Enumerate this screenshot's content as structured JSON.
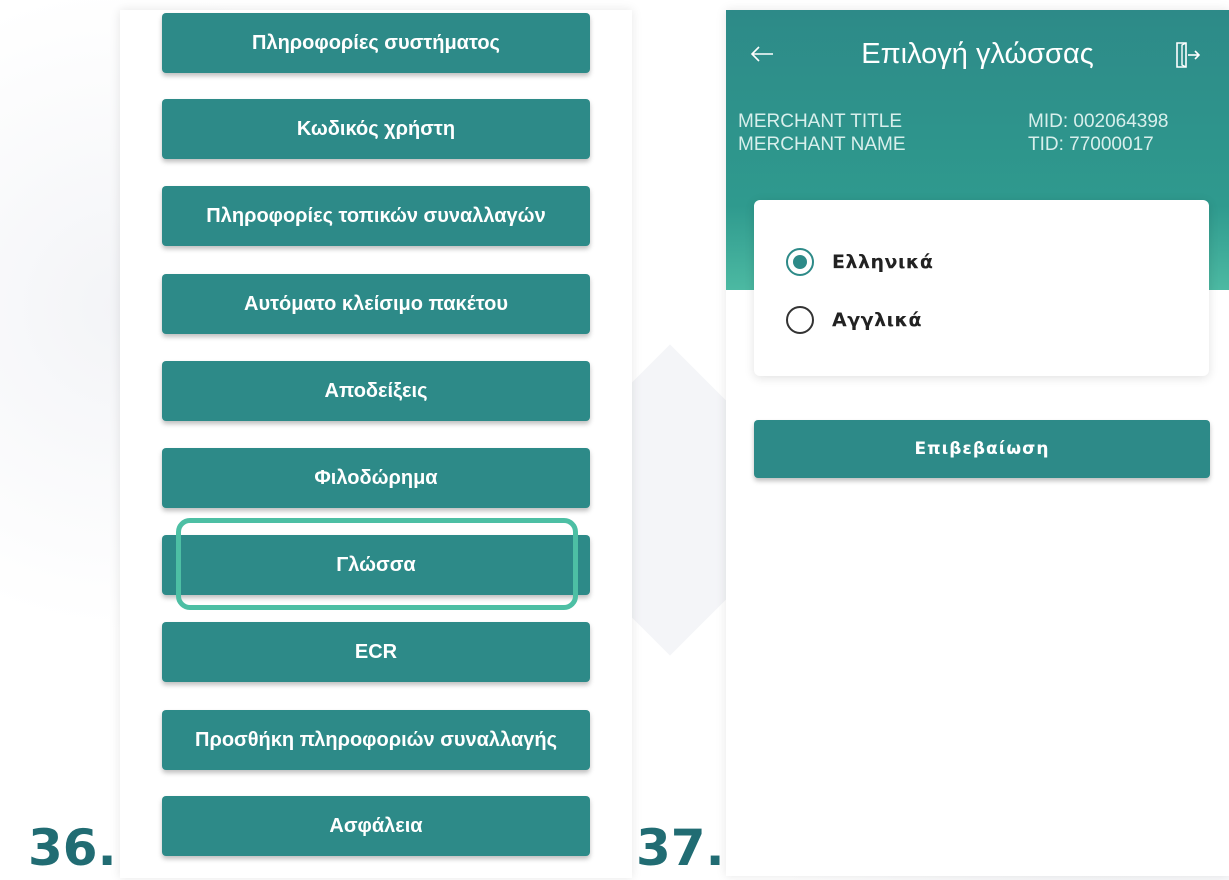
{
  "menu": {
    "items": [
      {
        "label": "Πληροφορίες συστήματος"
      },
      {
        "label": "Κωδικός χρήστη"
      },
      {
        "label": "Πληροφορίες τοπικών συναλλαγών"
      },
      {
        "label": "Αυτόματο κλείσιμο πακέτου"
      },
      {
        "label": "Αποδείξεις"
      },
      {
        "label": "Φιλοδώρημα"
      },
      {
        "label": "Γλώσσα"
      },
      {
        "label": "ECR"
      },
      {
        "label": "Προσθήκη πληροφοριών συναλλαγής"
      },
      {
        "label": "Ασφάλεια"
      }
    ],
    "highlighted_index": 6
  },
  "language_screen": {
    "back_icon": "arrow-left-icon",
    "title": "Επιλογή γλώσσας",
    "exit_icon": "logout-icon",
    "merchant_title": "MERCHANT TITLE",
    "merchant_name": "MERCHANT NAME",
    "mid": "MID: 002064398",
    "tid": "TID: 77000017",
    "options": [
      {
        "label": "Ελληνικά",
        "selected": true
      },
      {
        "label": "Αγγλικά",
        "selected": false
      }
    ],
    "confirm_label": "Επιβεβαίωση"
  },
  "steps": {
    "left": "36.",
    "right": "37."
  },
  "colors": {
    "teal": "#2d8a88",
    "highlight": "#4dbfa4",
    "step_number": "#216c73"
  }
}
